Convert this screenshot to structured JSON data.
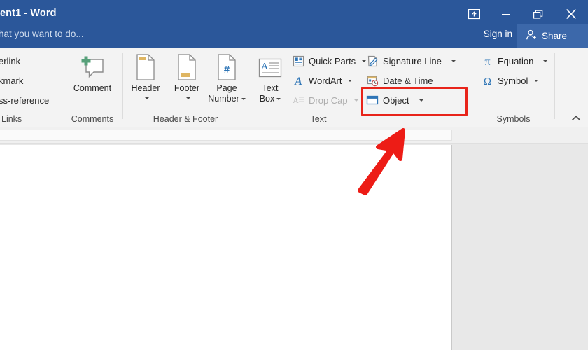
{
  "window": {
    "title": "ent1 - Word",
    "tell_me_placeholder": "hat you want to do...",
    "sign_in": "Sign in",
    "share": "Share",
    "controls": {
      "ribbon_display_options": "ribbon-display-options",
      "minimize": "minimize",
      "restore": "restore",
      "close": "close"
    },
    "accent_color": "#2b579a",
    "share_color": "#3c68aa"
  },
  "ribbon": {
    "groups": [
      {
        "label": "Links"
      },
      {
        "label": "Comments"
      },
      {
        "label": "Header & Footer"
      },
      {
        "label": "Text"
      },
      {
        "label": "Symbols"
      }
    ],
    "links_group": {
      "items": [
        {
          "label": "erlink"
        },
        {
          "label": "kmark"
        },
        {
          "label": "ss-reference"
        }
      ]
    },
    "comments_group": {
      "comment": {
        "label": "Comment",
        "icon": "comment-icon"
      }
    },
    "header_footer_group": {
      "header": {
        "label": "Header",
        "icon": "header-page-icon",
        "has_dropdown": true
      },
      "footer": {
        "label": "Footer",
        "icon": "footer-page-icon",
        "has_dropdown": true
      },
      "page_number": {
        "label_line1": "Page",
        "label_line2": "Number",
        "icon": "page-number-icon",
        "has_dropdown": true
      }
    },
    "text_group": {
      "text_box": {
        "label_line1": "Text",
        "label_line2": "Box",
        "icon": "text-box-icon",
        "has_dropdown": true
      },
      "quick_parts": {
        "label": "Quick Parts",
        "icon": "quick-parts-icon",
        "has_dropdown": true
      },
      "word_art": {
        "label": "WordArt",
        "icon": "wordart-icon",
        "has_dropdown": true
      },
      "drop_cap": {
        "label": "Drop Cap",
        "icon": "drop-cap-icon",
        "has_dropdown": true,
        "disabled": true
      },
      "signature_line": {
        "label": "Signature Line",
        "icon": "signature-line-icon",
        "has_dropdown": true
      },
      "date_time": {
        "label": "Date & Time",
        "icon": "date-time-icon"
      },
      "object": {
        "label": "Object",
        "icon": "object-icon",
        "has_dropdown": true,
        "highlighted": true
      }
    },
    "symbols_group": {
      "equation": {
        "label": "Equation",
        "icon": "equation-pi-icon",
        "has_dropdown": true
      },
      "symbol": {
        "label": "Symbol",
        "icon": "symbol-omega-icon",
        "has_dropdown": true
      }
    },
    "collapse_ribbon": "collapse-ribbon-chevron"
  },
  "annotation": {
    "highlight_color": "#e8241a",
    "highlight_target": "Object",
    "arrow": "red-arrow-pointing-to-object"
  }
}
